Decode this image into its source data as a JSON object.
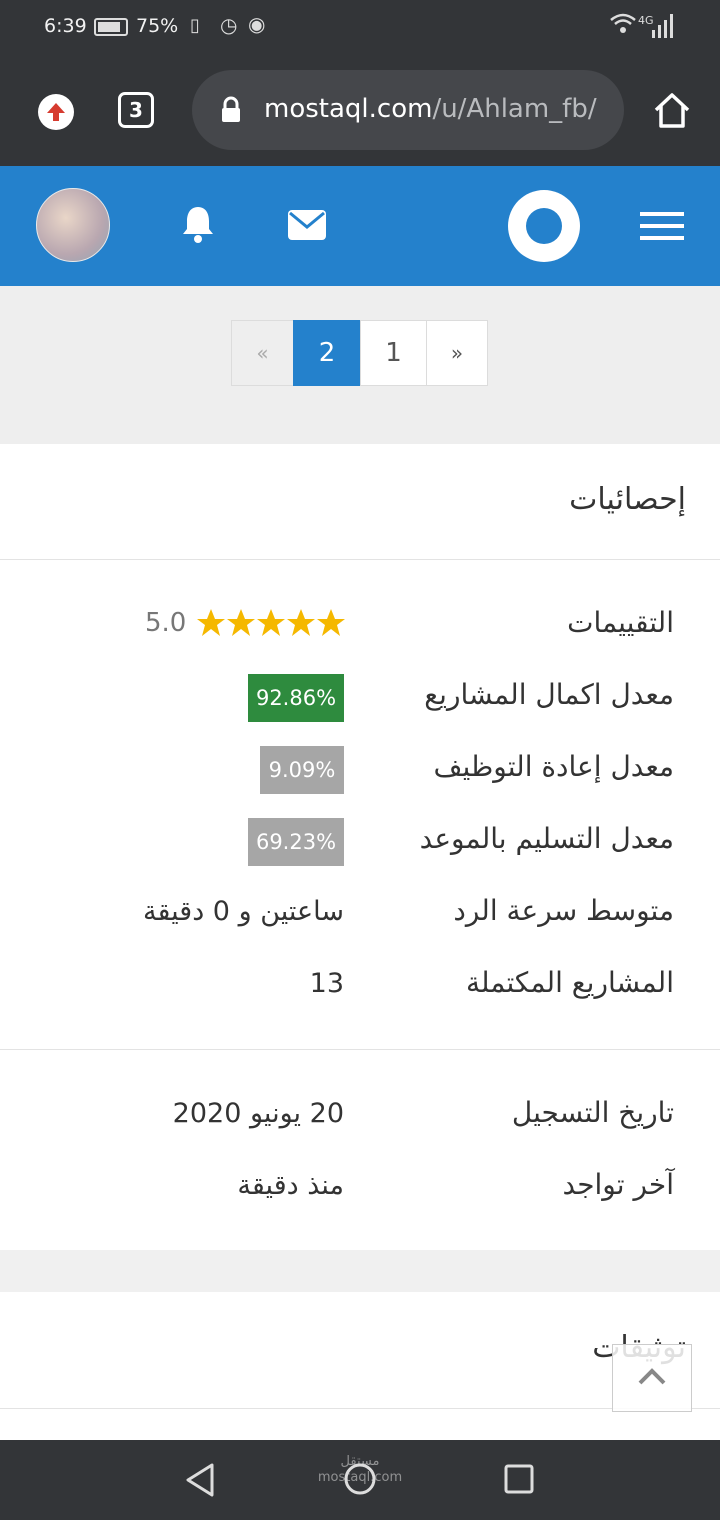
{
  "status_bar": {
    "time": "6:39",
    "battery": "75%",
    "network": "4G"
  },
  "browser": {
    "url_main": "mostaql.com",
    "url_path": "/u/Ahlam_fb/",
    "tab_count": "3"
  },
  "pagination": {
    "prev": "«",
    "pages": [
      "2",
      "1"
    ],
    "next": "»",
    "active": "2"
  },
  "stats": {
    "title": "إحصائيات",
    "ratings_label": "التقييمات",
    "rating_value": "5.0",
    "rating_stars": 5,
    "rows": [
      {
        "label": "معدل اكمال المشاريع",
        "value": "92.86%",
        "color": "#2e8b3e"
      },
      {
        "label": "معدل إعادة التوظيف",
        "value": "9.09%",
        "color": "#a6a6a6"
      },
      {
        "label": "معدل التسليم بالموعد",
        "value": "69.23%",
        "color": "#a6a6a6"
      }
    ],
    "response_label": "متوسط سرعة الرد",
    "response_value": "ساعتين و 0 دقيقة",
    "completed_label": "المشاريع المكتملة",
    "completed_value": "13",
    "register_label": "تاريخ التسجيل",
    "register_value": "20 يونيو 2020",
    "last_seen_label": "آخر تواجد",
    "last_seen_value": "منذ دقيقة"
  },
  "verifications": {
    "title": "توثيقات"
  },
  "watermark": "مستقل mostaql.com",
  "colors": {
    "brand_blue": "#2481cc",
    "star": "#f5b800",
    "badge_green": "#2e8b3e",
    "badge_gray": "#a6a6a6"
  }
}
